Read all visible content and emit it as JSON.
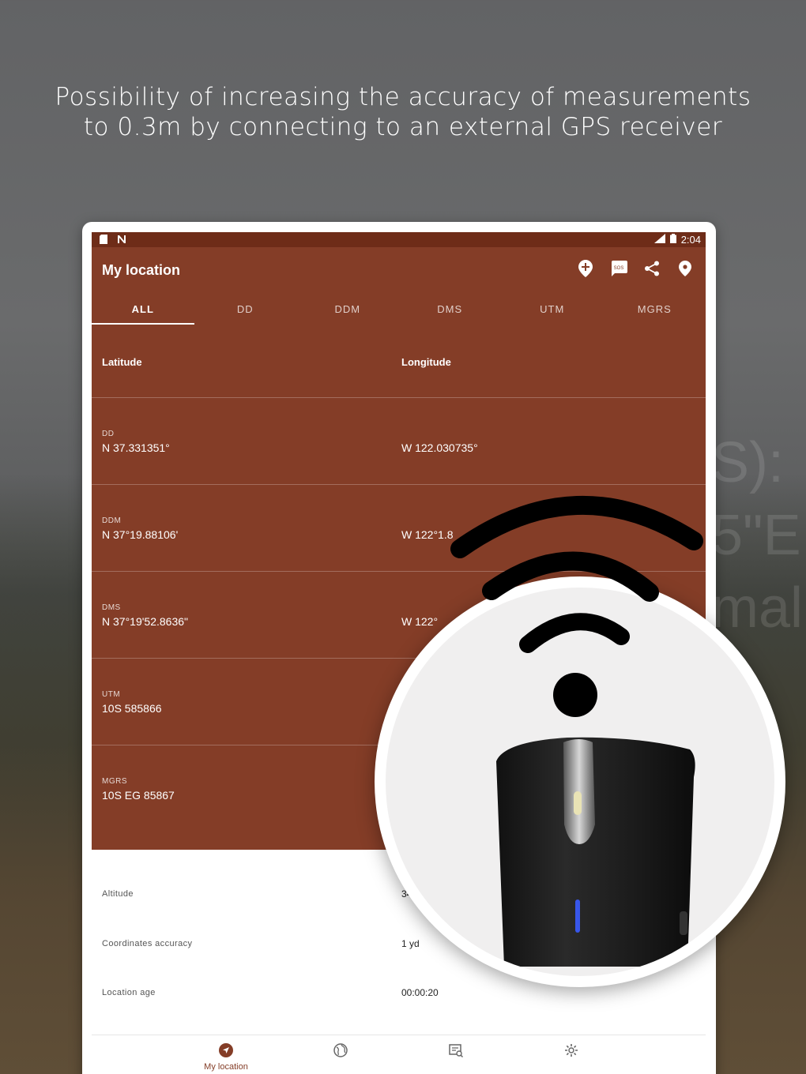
{
  "headline": "Possibility of increasing the accuracy of measurements to 0.3m by connecting to an external GPS receiver",
  "background_text": "S):\n5\"E\nmal\n'1\n3\n\n3",
  "status_bar": {
    "time": "2:04",
    "network": "LTE"
  },
  "app_bar": {
    "title": "My location",
    "actions": [
      "add-location-icon",
      "sos-icon",
      "share-icon",
      "location-pin-icon"
    ],
    "sos_label": "SOS"
  },
  "tabs": [
    "ALL",
    "DD",
    "DDM",
    "DMS",
    "UTM",
    "MGRS"
  ],
  "active_tab": "ALL",
  "columns": {
    "latitude": "Latitude",
    "longitude": "Longitude"
  },
  "coordinates": [
    {
      "label": "DD",
      "lat": "N 37.331351°",
      "lon": "W 122.030735°"
    },
    {
      "label": "DDM",
      "lat": "N 37°19.88106'",
      "lon": "W 122°1.8"
    },
    {
      "label": "DMS",
      "lat": "N 37°19'52.8636\"",
      "lon": "W 122°"
    },
    {
      "label": "UTM",
      "lat": "10S 585866",
      "lon": ""
    },
    {
      "label": "MGRS",
      "lat": "10S EG 85867",
      "lon": ""
    }
  ],
  "info": [
    {
      "key": "Altitude",
      "value": "34"
    },
    {
      "key": "Coordinates accuracy",
      "value": "1 yd"
    },
    {
      "key": "Location age",
      "value": "00:00:20"
    }
  ],
  "bottom_nav": {
    "items": [
      "My location",
      "",
      "",
      ""
    ],
    "icons": [
      "navigation-arrow-icon",
      "globe-icon",
      "map-search-icon",
      "settings-gear-icon"
    ],
    "active": "My location"
  },
  "colors": {
    "primary": "#843d27",
    "status_bar": "#6e2c18",
    "white": "#ffffff"
  }
}
